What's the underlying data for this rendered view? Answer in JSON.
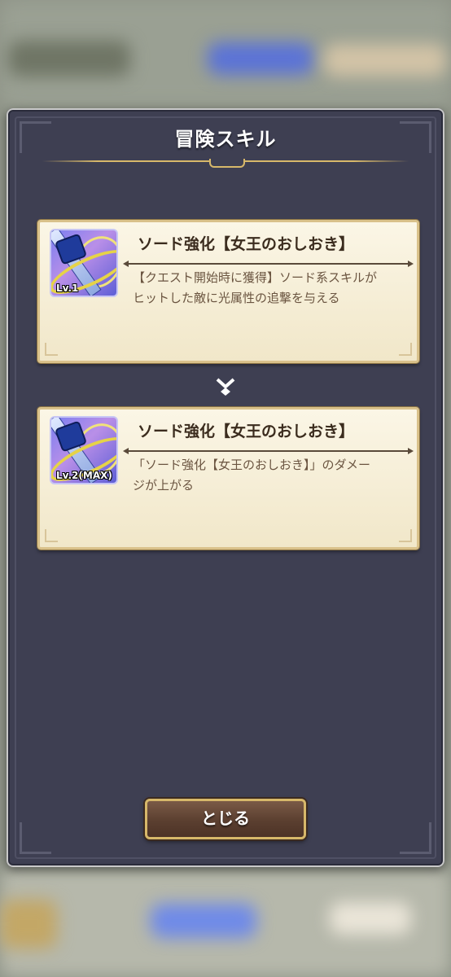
{
  "modal": {
    "title": "冒険スキル",
    "close_label": "とじる"
  },
  "skills": [
    {
      "name": "ソード強化【女王のおしおき】",
      "level": "Lv.1",
      "description_line1": "【クエスト開始時に獲得】ソード系スキルが",
      "description_line2": "ヒットした敵に光属性の追撃を与える",
      "icon": "sword-skill-icon"
    },
    {
      "name": "ソード強化【女王のおしおき】",
      "level": "Lv.2(MAX)",
      "description_line1": "「ソード強化【女王のおしおき】」のダメー",
      "description_line2": "ジが上がる",
      "icon": "sword-skill-icon"
    }
  ],
  "colors": {
    "modal_bg": "#3e3f52",
    "card_bg": "#fbf6e6",
    "gold_accent": "#d7b86a",
    "button_bg": "#5b3f30"
  }
}
